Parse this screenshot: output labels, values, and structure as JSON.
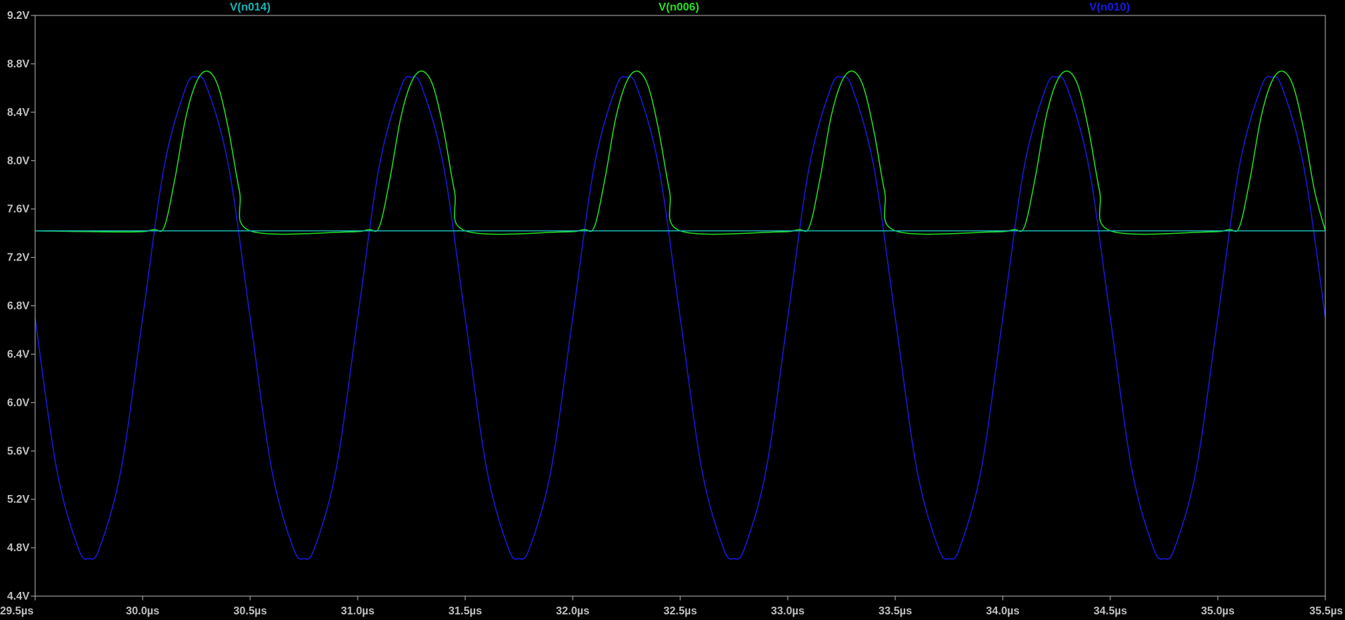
{
  "chart_data": {
    "type": "line",
    "background": "#000000",
    "frame_color": "#b8b8b8",
    "grid": false,
    "legend_placement": "top",
    "x_unit": "µs",
    "y_unit": "V",
    "xlim": [
      29.5,
      35.5
    ],
    "ylim": [
      4.4,
      9.2
    ],
    "x_ticks": [
      "29.5µs",
      "30.0µs",
      "30.5µs",
      "31.0µs",
      "31.5µs",
      "32.0µs",
      "32.5µs",
      "33.0µs",
      "33.5µs",
      "34.0µs",
      "34.5µs",
      "35.0µs",
      "35.5µs"
    ],
    "x_tick_values": [
      29.5,
      30.0,
      30.5,
      31.0,
      31.5,
      32.0,
      32.5,
      33.0,
      33.5,
      34.0,
      34.5,
      35.0,
      35.5
    ],
    "y_ticks": [
      "9.2V",
      "8.8V",
      "8.4V",
      "8.0V",
      "7.6V",
      "7.2V",
      "6.8V",
      "6.4V",
      "6.0V",
      "5.6V",
      "5.2V",
      "4.8V",
      "4.4V"
    ],
    "y_tick_values": [
      9.2,
      8.8,
      8.4,
      8.0,
      7.6,
      7.2,
      6.8,
      6.4,
      6.0,
      5.6,
      5.2,
      4.8,
      4.4
    ],
    "series": [
      {
        "name": "V(n014)",
        "color": "#18b4b4",
        "x": [
          29.5,
          35.5
        ],
        "y": [
          7.42,
          7.42
        ]
      },
      {
        "name": "V(n006)",
        "color": "#22e022",
        "x": [
          29.5,
          29.95,
          30.05,
          30.1,
          30.15,
          30.2,
          30.25,
          30.3,
          30.35,
          30.4,
          30.45,
          30.5,
          30.95,
          31.05,
          31.1,
          31.15,
          31.2,
          31.25,
          31.3,
          31.35,
          31.4,
          31.45,
          31.5,
          31.95,
          32.05,
          32.1,
          32.15,
          32.2,
          32.25,
          32.3,
          32.35,
          32.4,
          32.45,
          32.5,
          32.95,
          33.05,
          33.1,
          33.15,
          33.2,
          33.25,
          33.3,
          33.35,
          33.4,
          33.45,
          33.5,
          33.95,
          34.05,
          34.1,
          34.15,
          34.2,
          34.25,
          34.3,
          34.35,
          34.4,
          34.45,
          34.5,
          34.95,
          35.05,
          35.1,
          35.15,
          35.2,
          35.25,
          35.3,
          35.35,
          35.4,
          35.45,
          35.5
        ],
        "y": [
          7.42,
          7.41,
          7.43,
          7.45,
          7.85,
          8.35,
          8.65,
          8.74,
          8.62,
          8.25,
          7.75,
          7.42,
          7.41,
          7.43,
          7.45,
          7.85,
          8.35,
          8.65,
          8.74,
          8.62,
          8.25,
          7.75,
          7.42,
          7.41,
          7.43,
          7.45,
          7.85,
          8.35,
          8.65,
          8.74,
          8.62,
          8.25,
          7.75,
          7.42,
          7.41,
          7.43,
          7.45,
          7.85,
          8.35,
          8.65,
          8.74,
          8.62,
          8.25,
          7.75,
          7.42,
          7.41,
          7.43,
          7.45,
          7.85,
          8.35,
          8.65,
          8.74,
          8.62,
          8.25,
          7.75,
          7.42,
          7.41,
          7.43,
          7.45,
          7.85,
          8.35,
          8.65,
          8.74,
          8.62,
          8.25,
          7.75,
          7.42
        ]
      },
      {
        "name": "V(n010)",
        "color": "#1a1ae0",
        "x": [
          29.5,
          29.6,
          29.7,
          29.75,
          29.8,
          29.9,
          30.0,
          30.1,
          30.2,
          30.25,
          30.3,
          30.4,
          30.5,
          30.6,
          30.7,
          30.75,
          30.8,
          30.9,
          31.0,
          31.1,
          31.2,
          31.25,
          31.3,
          31.4,
          31.5,
          31.6,
          31.7,
          31.75,
          31.8,
          31.9,
          32.0,
          32.1,
          32.2,
          32.25,
          32.3,
          32.4,
          32.5,
          32.6,
          32.7,
          32.75,
          32.8,
          32.9,
          33.0,
          33.1,
          33.2,
          33.25,
          33.3,
          33.4,
          33.5,
          33.6,
          33.7,
          33.75,
          33.8,
          33.9,
          34.0,
          34.1,
          34.2,
          34.25,
          34.3,
          34.4,
          34.5,
          34.6,
          34.7,
          34.75,
          34.8,
          34.9,
          35.0,
          35.1,
          35.2,
          35.25,
          35.3,
          35.4,
          35.5
        ],
        "y": [
          6.7,
          5.45,
          4.8,
          4.71,
          4.8,
          5.45,
          6.7,
          7.95,
          8.6,
          8.69,
          8.6,
          7.95,
          6.7,
          5.45,
          4.8,
          4.71,
          4.8,
          5.45,
          6.7,
          7.95,
          8.6,
          8.69,
          8.6,
          7.95,
          6.7,
          5.45,
          4.8,
          4.71,
          4.8,
          5.45,
          6.7,
          7.95,
          8.6,
          8.69,
          8.6,
          7.95,
          6.7,
          5.45,
          4.8,
          4.71,
          4.8,
          5.45,
          6.7,
          7.95,
          8.6,
          8.69,
          8.6,
          7.95,
          6.7,
          5.45,
          4.8,
          4.71,
          4.8,
          5.45,
          6.7,
          7.95,
          8.6,
          8.69,
          8.6,
          7.95,
          6.7,
          5.45,
          4.8,
          4.71,
          4.8,
          5.45,
          6.7,
          7.95,
          8.6,
          8.69,
          8.6,
          7.95,
          6.7
        ]
      }
    ]
  }
}
